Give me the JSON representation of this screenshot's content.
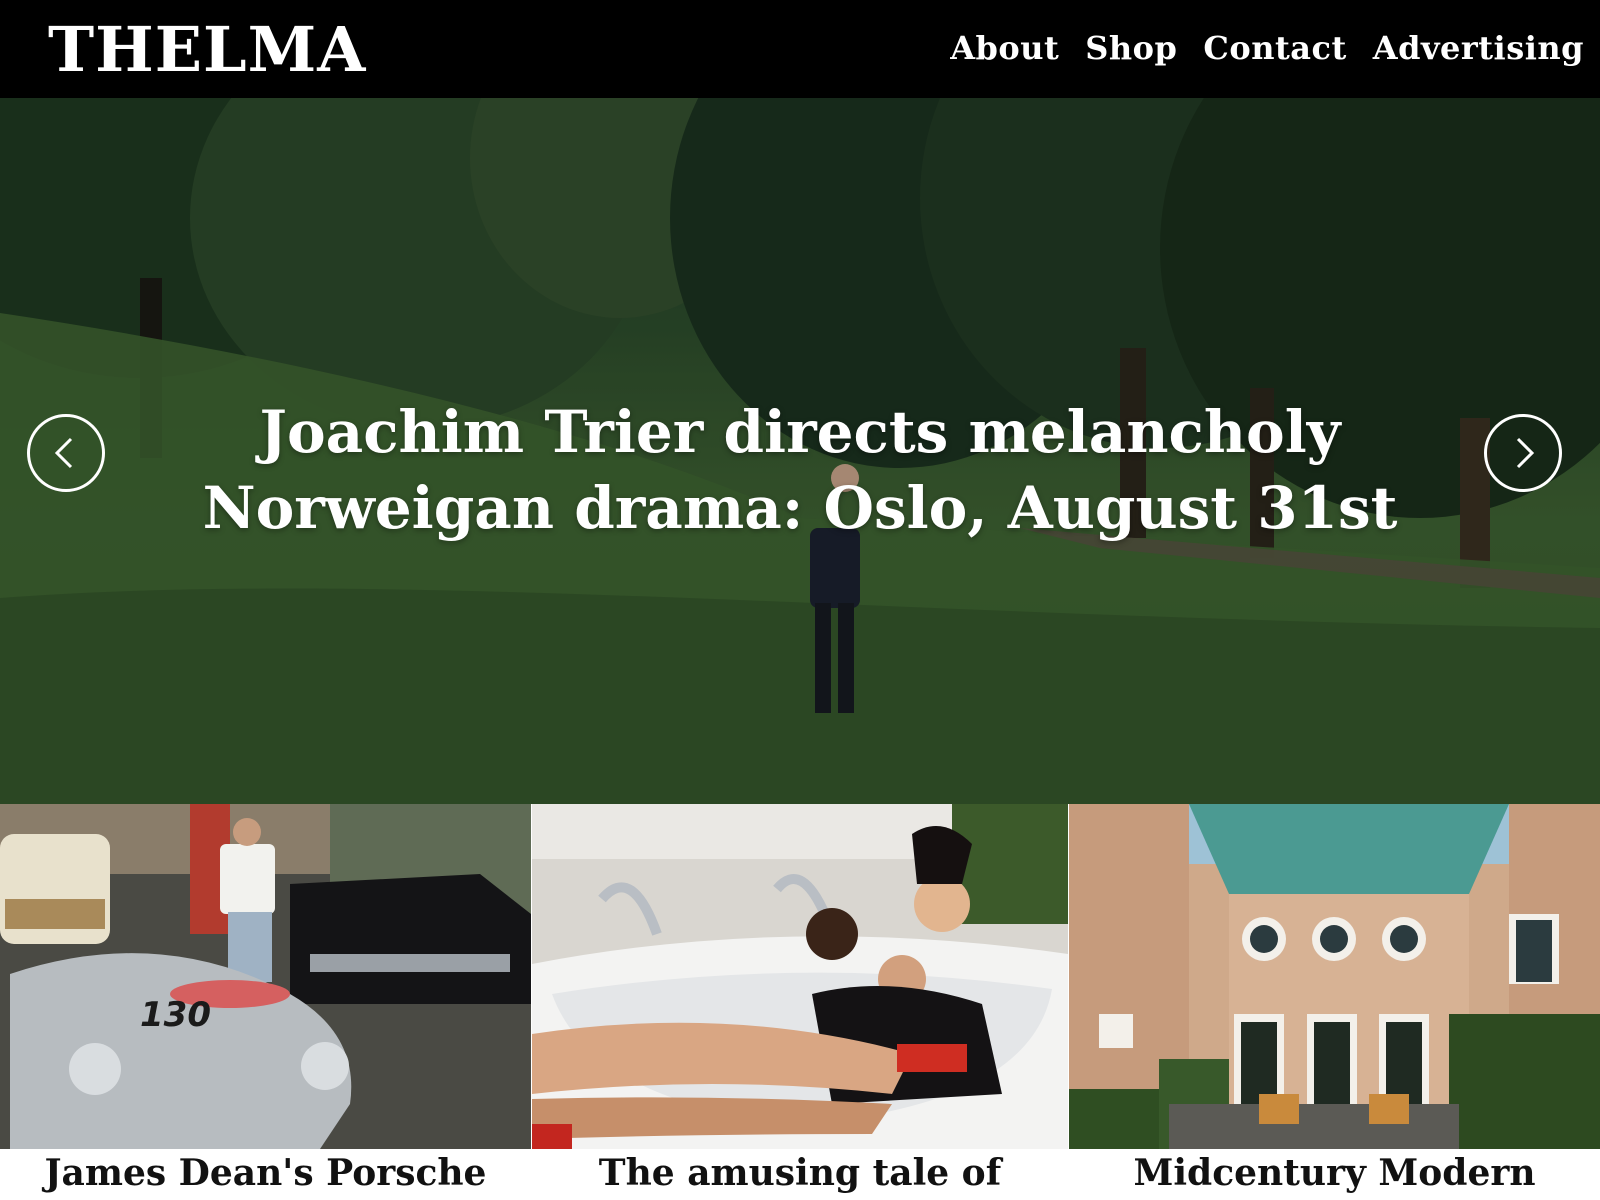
{
  "site": {
    "logo": "THELMA"
  },
  "nav": {
    "items": [
      "About",
      "Shop",
      "Contact",
      "Advertising"
    ]
  },
  "hero": {
    "title_line1": "Joachim Trier directs melancholy",
    "title_line2": "Norweigan drama: Oslo, August 31st",
    "prev_icon": "chevron-left-icon",
    "next_icon": "chevron-right-icon"
  },
  "cards": [
    {
      "title": "James Dean's Porsche",
      "image": "vintage cars photo"
    },
    {
      "title": "The amusing tale of",
      "image": "women in bathtub photo"
    },
    {
      "title": "Midcentury Modern",
      "image": "brick house exterior photo"
    }
  ],
  "colors": {
    "header_bg": "#000000",
    "text_light": "#ffffff",
    "text_dark": "#111111"
  }
}
